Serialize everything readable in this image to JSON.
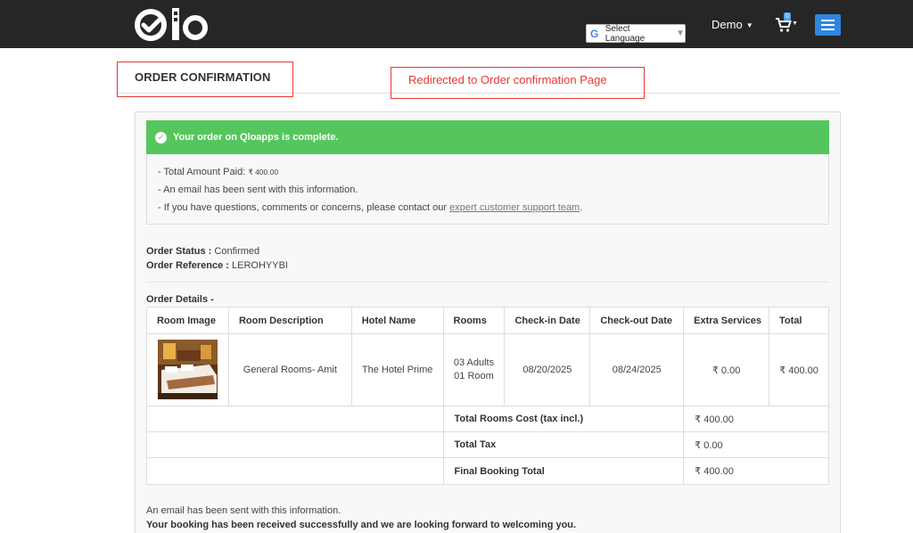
{
  "header": {
    "language_label": "Select Language",
    "language_caret": "▼",
    "account_label": "Demo",
    "cart_count": "0"
  },
  "page": {
    "title": "ORDER CONFIRMATION",
    "annotation": "Redirected to Order confirmation Page"
  },
  "alert": {
    "message": "Your order on Qloapps is complete.",
    "amount_prefix": "- Total Amount Paid: ",
    "amount_value": "₹ 400.00",
    "email_line": "- An email has been sent with this information.",
    "contact_prefix": "- If you have questions, comments or concerns, please contact our ",
    "contact_link": "expert customer support team",
    "contact_suffix": "."
  },
  "order": {
    "status_label": "Order Status :",
    "status_value": " Confirmed",
    "reference_label": "Order Reference :",
    "reference_value": " LEROHYYBI",
    "details_label": "Order Details -"
  },
  "table": {
    "headers": [
      "Room Image",
      "Room Description",
      "Hotel Name",
      "Rooms",
      "Check-in Date",
      "Check-out Date",
      "Extra Services",
      "Total"
    ],
    "row": {
      "description": "General Rooms- Amit",
      "hotel": "The Hotel Prime",
      "adults": "03 Adults",
      "rooms": "01 Room",
      "checkin": "08/20/2025",
      "checkout": "08/24/2025",
      "extra": "₹ 0.00",
      "total": "₹ 400.00"
    },
    "summary": [
      {
        "label": "Total Rooms Cost (tax incl.)",
        "value": "₹ 400.00"
      },
      {
        "label": "Total Tax",
        "value": "₹ 0.00"
      },
      {
        "label": "Final Booking Total",
        "value": "₹ 400.00"
      }
    ]
  },
  "footer": {
    "email_note": "An email has been sent with this information.",
    "thanks": "Your booking has been received successfully and we are looking forward to welcoming you."
  },
  "colors": {
    "topbar": "#262626",
    "success": "#55c65e",
    "menu_button": "#2e86de",
    "annotation": "#e53935"
  }
}
